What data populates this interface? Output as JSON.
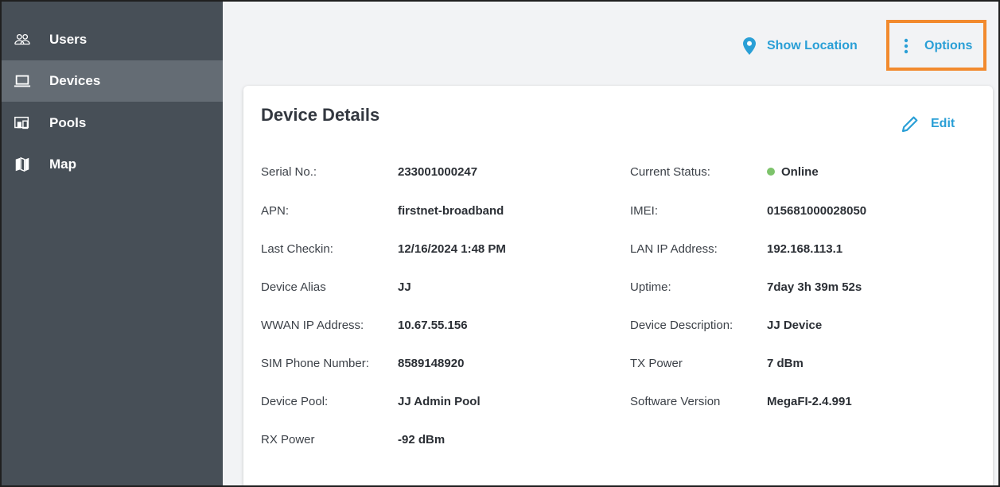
{
  "sidebar": {
    "items": [
      {
        "label": "Users",
        "icon": "users-icon",
        "active": false
      },
      {
        "label": "Devices",
        "icon": "laptop-icon",
        "active": true
      },
      {
        "label": "Pools",
        "icon": "devices-pool-icon",
        "active": false
      },
      {
        "label": "Map",
        "icon": "map-icon",
        "active": false
      }
    ]
  },
  "header": {
    "show_location_label": "Show Location",
    "options_label": "Options"
  },
  "card": {
    "title": "Device Details",
    "edit_label": "Edit",
    "left_fields": [
      {
        "label": "Serial No.:",
        "value": "233001000247"
      },
      {
        "label": "APN:",
        "value": "firstnet-broadband"
      },
      {
        "label": "Last Checkin:",
        "value": "12/16/2024 1:48 PM"
      },
      {
        "label": "Device Alias",
        "value": "JJ"
      },
      {
        "label": "WWAN IP Address:",
        "value": "10.67.55.156"
      },
      {
        "label": "SIM Phone Number:",
        "value": "8589148920"
      },
      {
        "label": "Device Pool:",
        "value": "JJ Admin Pool"
      },
      {
        "label": "RX Power",
        "value": "-92 dBm"
      }
    ],
    "right_fields": [
      {
        "label": "Current Status:",
        "value": "Online"
      },
      {
        "label": "IMEI:",
        "value": "015681000028050"
      },
      {
        "label": "LAN IP Address:",
        "value": "192.168.113.1"
      },
      {
        "label": "Uptime:",
        "value": "7day 3h 39m 52s"
      },
      {
        "label": "Device Description:",
        "value": "JJ Device"
      },
      {
        "label": "TX Power",
        "value": "7 dBm"
      },
      {
        "label": "Software Version",
        "value": "MegaFI-2.4.991"
      }
    ]
  },
  "colors": {
    "sidebar_bg": "#474f57",
    "sidebar_active": "#646c74",
    "accent": "#2a9fd6",
    "highlight_box": "#f28a2e",
    "online_status": "#7dc36b"
  }
}
